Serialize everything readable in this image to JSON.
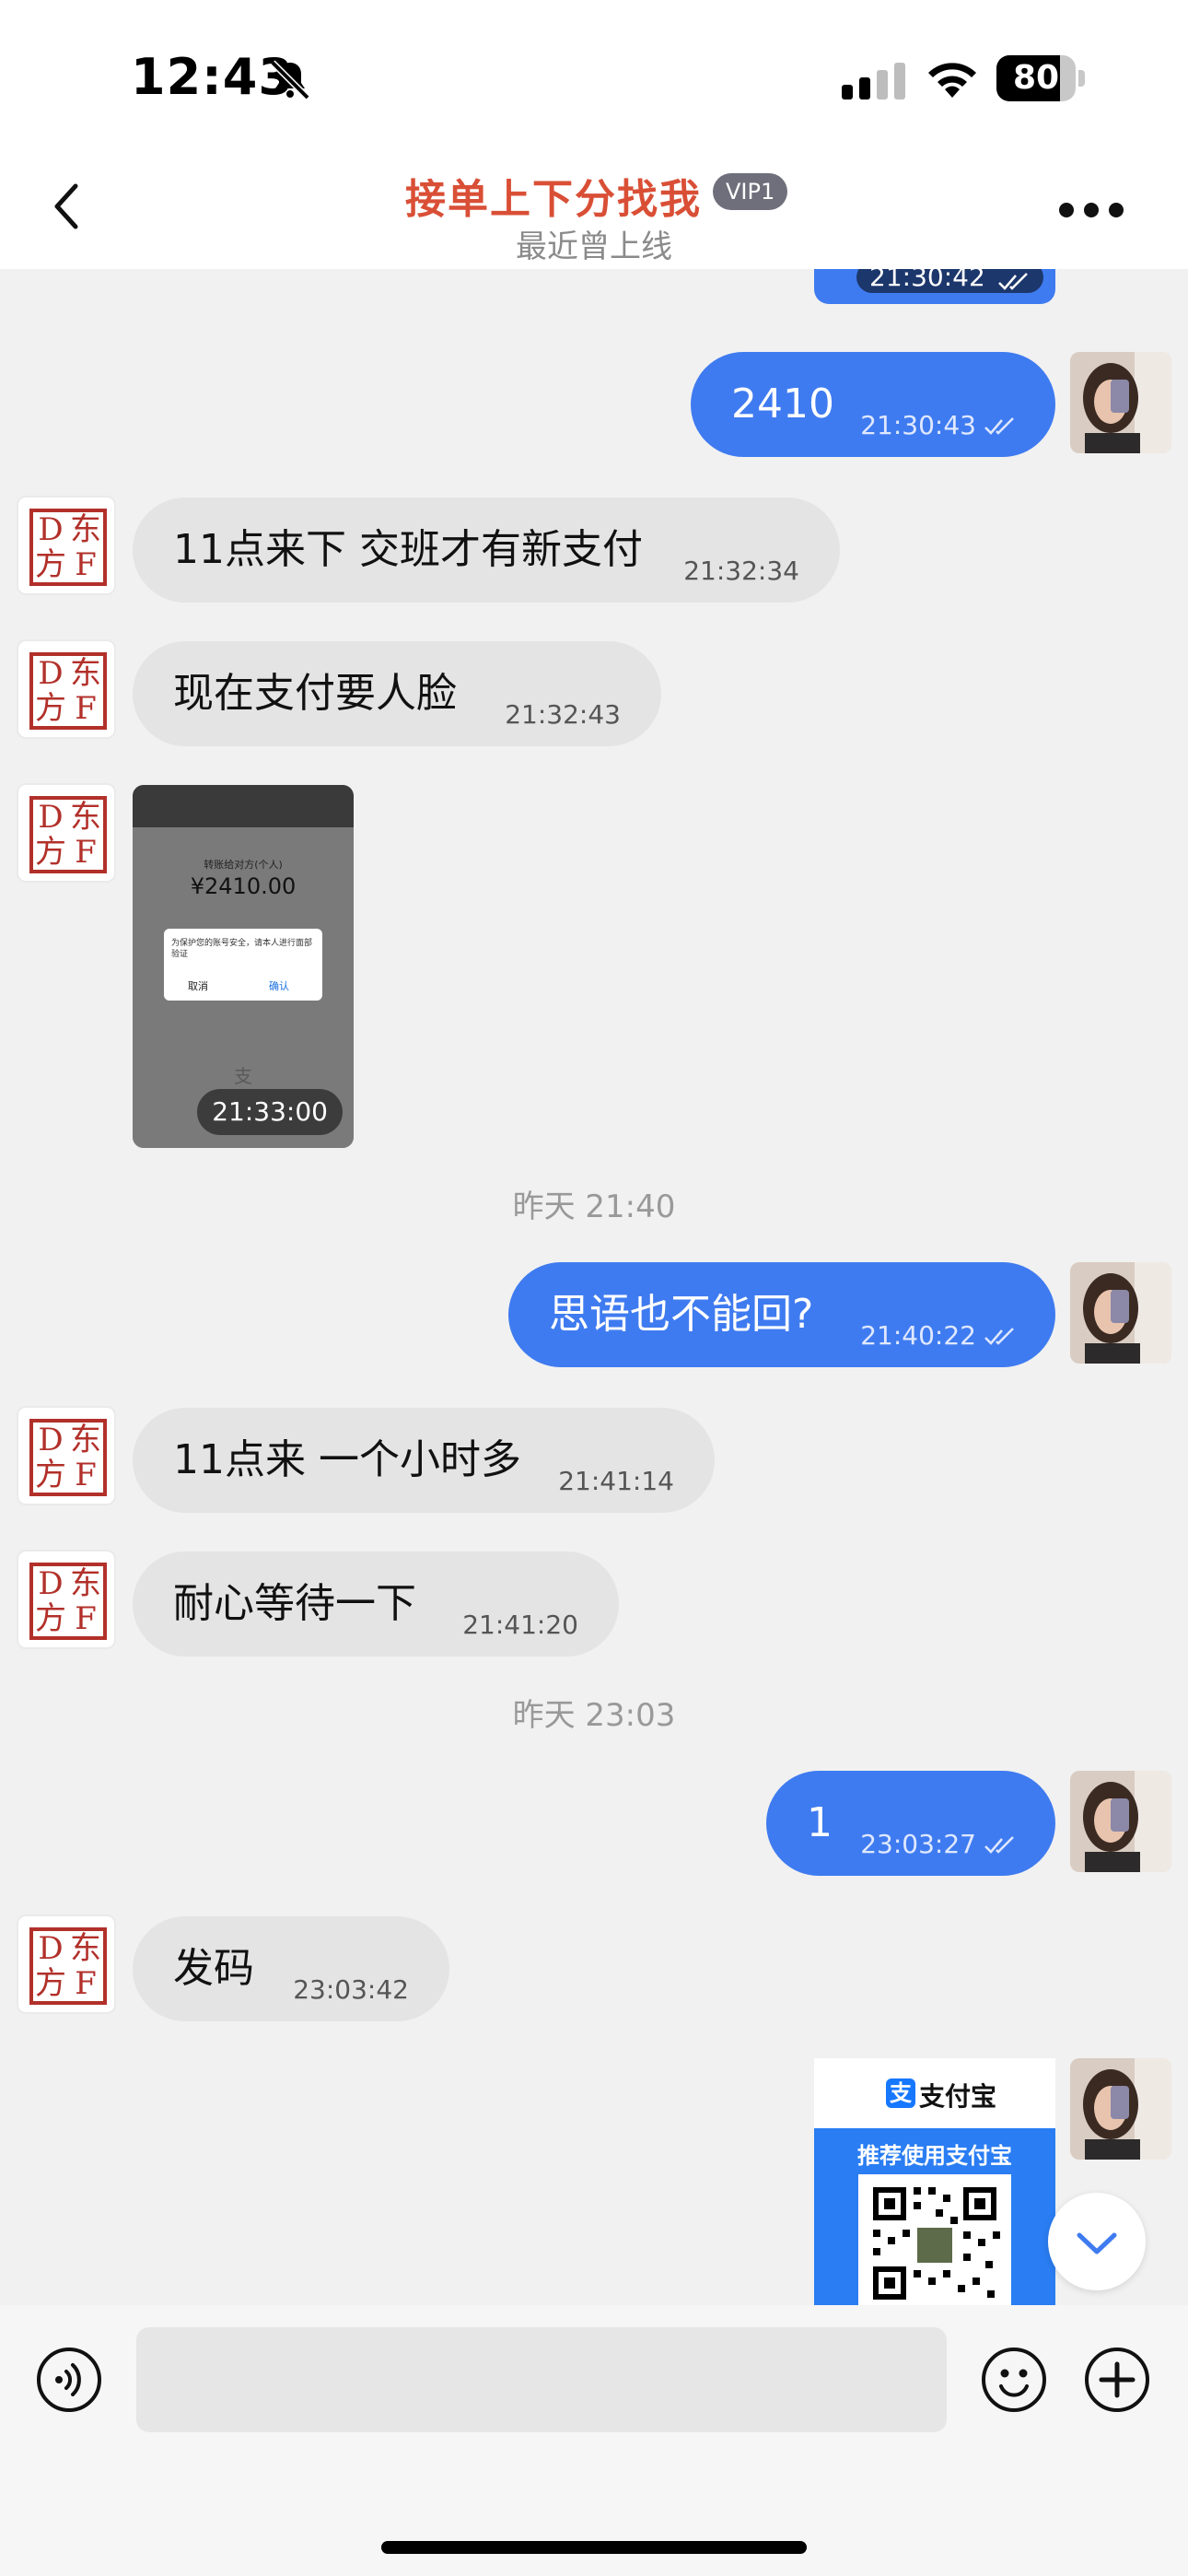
{
  "status_bar": {
    "time": "12:43",
    "battery": "80",
    "battery_level": 0.8,
    "icons": [
      "bell-muted-icon",
      "cellular-signal-icon",
      "wifi-icon",
      "battery-icon"
    ]
  },
  "header": {
    "title": "接单上下分找我",
    "badge": "VIP1",
    "subtitle": "最近曾上线",
    "icons": [
      "back-chevron-icon",
      "more-dots-icon"
    ]
  },
  "contact_avatar": {
    "seal_chars": [
      "D",
      "东",
      "方",
      "F"
    ],
    "seal_color": "#b2302a"
  },
  "messages": [
    {
      "id": "m0",
      "dir": "out",
      "type": "text",
      "text": "",
      "time": "21:30:42",
      "read": true
    },
    {
      "id": "m1",
      "dir": "out",
      "type": "text",
      "text": "2410",
      "time": "21:30:43",
      "read": true
    },
    {
      "id": "m2",
      "dir": "in",
      "type": "text",
      "text": "11点来下 交班才有新支付",
      "time": "21:32:34"
    },
    {
      "id": "m3",
      "dir": "in",
      "type": "text",
      "text": "现在支付要人脸",
      "time": "21:32:43"
    },
    {
      "id": "m4",
      "dir": "in",
      "type": "image",
      "time": "21:33:00",
      "screenshot": {
        "title": "转账给对方(个人)",
        "amount": "¥2410.00",
        "dialog_text": "为保护您的账号安全，请本人进行面部验证",
        "cancel": "取消",
        "confirm": "确认",
        "footer": "支"
      }
    },
    {
      "id": "sep1",
      "type": "separator",
      "text": "昨天 21:40"
    },
    {
      "id": "m5",
      "dir": "out",
      "type": "text",
      "text": "思语也不能回?",
      "time": "21:40:22",
      "read": true
    },
    {
      "id": "m6",
      "dir": "in",
      "type": "text",
      "text": "11点来 一个小时多",
      "time": "21:41:14"
    },
    {
      "id": "m7",
      "dir": "in",
      "type": "text",
      "text": "耐心等待一下",
      "time": "21:41:20"
    },
    {
      "id": "sep2",
      "type": "separator",
      "text": "昨天 23:03"
    },
    {
      "id": "m8",
      "dir": "out",
      "type": "text",
      "text": "1",
      "time": "23:03:27",
      "read": true
    },
    {
      "id": "m9",
      "dir": "in",
      "type": "text",
      "text": "发码",
      "time": "23:03:42"
    },
    {
      "id": "m10",
      "dir": "out",
      "type": "qr_card",
      "brand": "支付宝",
      "tagline": "推荐使用支付宝"
    }
  ],
  "input_bar": {
    "placeholder": "",
    "icons": [
      "voice-icon",
      "emoji-icon",
      "plus-icon"
    ]
  },
  "colors": {
    "outgoing_bubble": "#3f7bf0",
    "incoming_bubble": "#e4e4e4",
    "title_red": "#d94f36",
    "background": "#f1f1f1"
  }
}
